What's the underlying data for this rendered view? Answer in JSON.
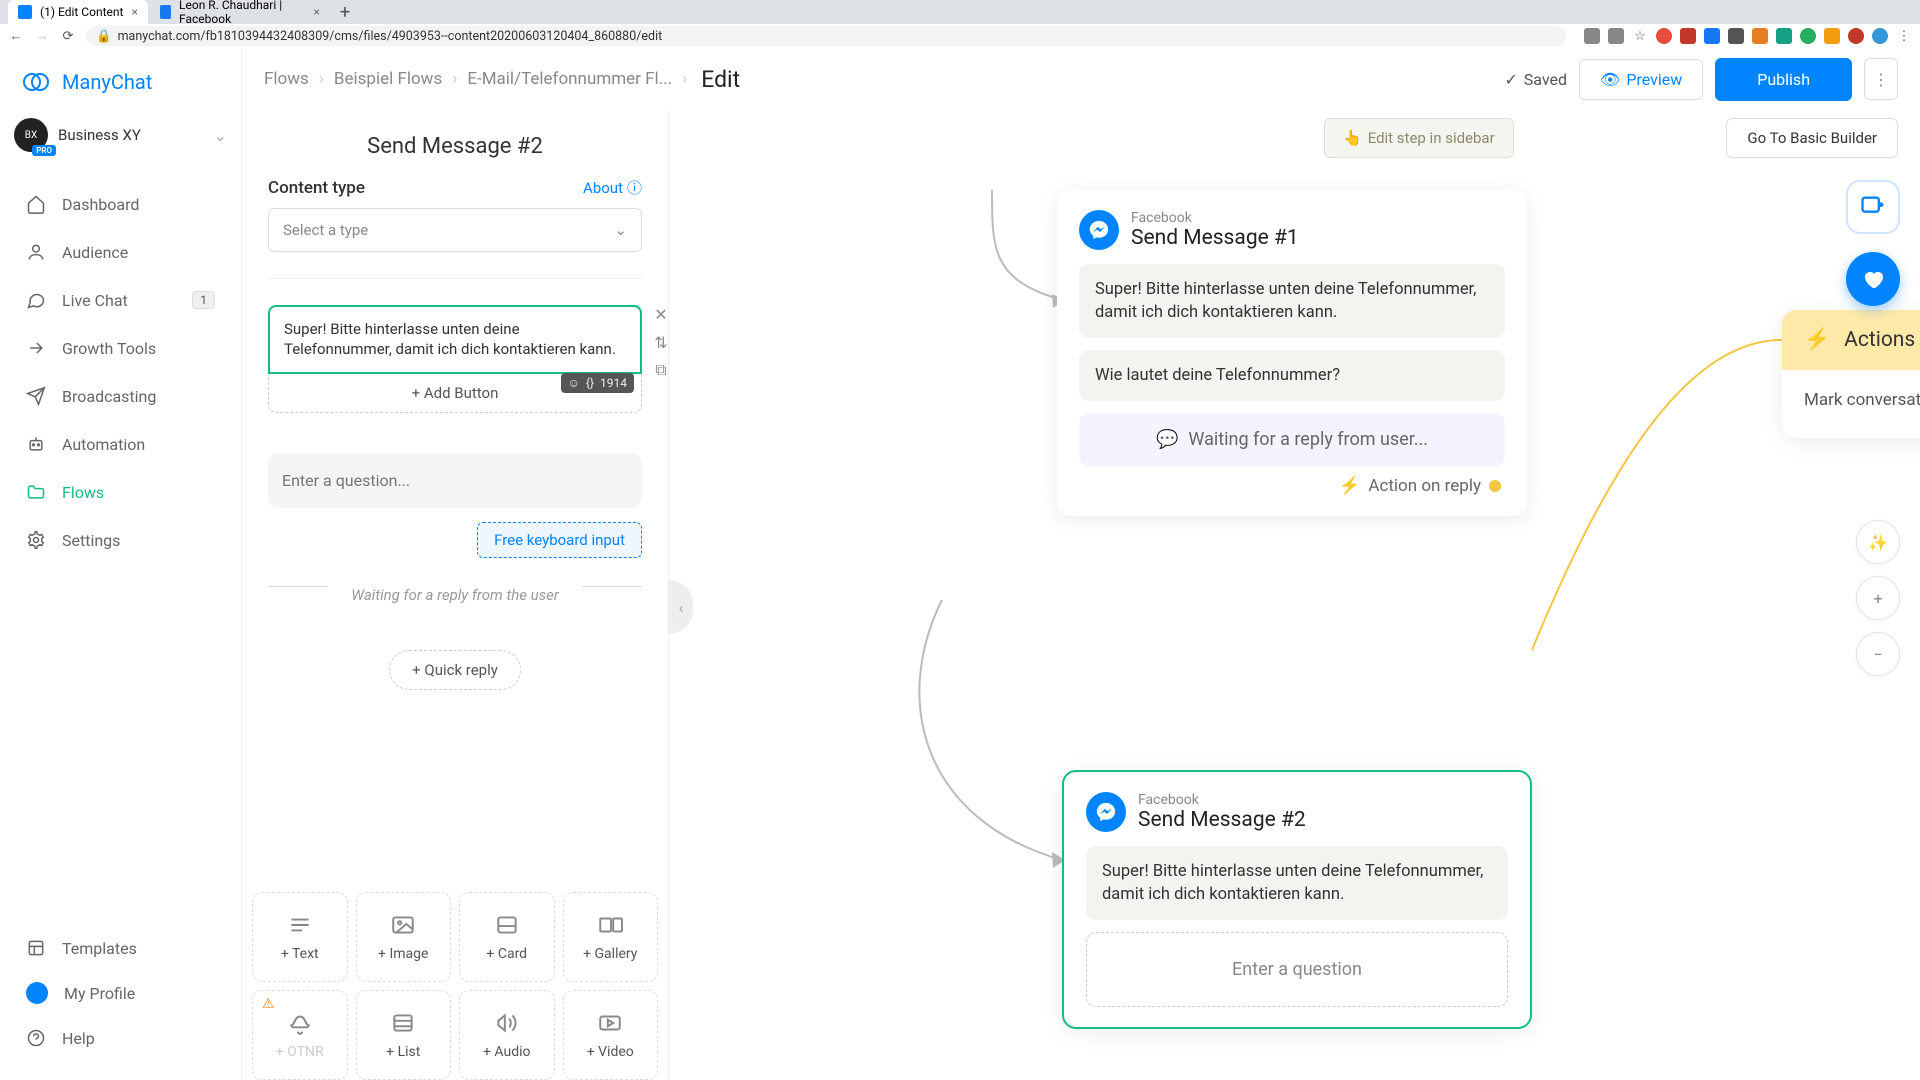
{
  "browser": {
    "tabs": [
      {
        "title": "(1) Edit Content",
        "favicon": "#0084ff"
      },
      {
        "title": "Leon R. Chaudhari | Facebook",
        "favicon": "#1877f2"
      }
    ],
    "url": "manychat.com/fb181039443240830​9/cms/files/4903953--content20200603120404_860880/edit"
  },
  "brand": "ManyChat",
  "org": {
    "name": "Business XY",
    "badge": "PRO"
  },
  "nav": {
    "items": [
      {
        "label": "Dashboard"
      },
      {
        "label": "Audience"
      },
      {
        "label": "Live Chat",
        "badge": "1"
      },
      {
        "label": "Growth Tools"
      },
      {
        "label": "Broadcasting"
      },
      {
        "label": "Automation"
      },
      {
        "label": "Flows",
        "active": true
      },
      {
        "label": "Settings"
      }
    ],
    "bottom": [
      {
        "label": "Templates"
      },
      {
        "label": "My Profile"
      },
      {
        "label": "Help"
      }
    ]
  },
  "breadcrumb": {
    "items": [
      "Flows",
      "Beispiel Flows",
      "E-Mail/Telefonnummer Fl..."
    ],
    "current": "Edit"
  },
  "topbar": {
    "saved": "Saved",
    "preview": "Preview",
    "publish": "Publish"
  },
  "canvas": {
    "edit_step": "Edit step in sidebar",
    "basic_builder": "Go To Basic Builder"
  },
  "editor": {
    "title": "Send Message #2",
    "content_type_label": "Content type",
    "about": "About",
    "select_placeholder": "Select a type",
    "message_text": "Super! Bitte hinterlasse unten deine Telefonnummer, damit ich dich kontaktieren kann.",
    "add_button": "+ Add Button",
    "char_count": "1914",
    "question_placeholder": "Enter a question...",
    "free_keyboard": "Free keyboard input",
    "waiting": "Waiting for a reply from the user",
    "quick_reply": "+ Quick reply",
    "blocks": [
      "+ Text",
      "+ Image",
      "+ Card",
      "+ Gallery",
      "+ OTNR",
      "+ List",
      "+ Audio",
      "+ Video"
    ]
  },
  "nodes": {
    "n1": {
      "platform": "Facebook",
      "title": "Send Message #1",
      "msg1": "Super! Bitte hinterlasse unten deine Telefonnummer, damit ich dich kontaktieren kann.",
      "msg2": "Wie lautet deine Telefonnummer?",
      "waiting": "Waiting for a reply from user...",
      "action_reply": "Action on reply"
    },
    "n2": {
      "platform": "Facebook",
      "title": "Send Message #2",
      "msg1": "Super! Bitte hinterlasse unten deine Telefonnummer, damit ich dich kontaktieren kann.",
      "question": "Enter a question"
    },
    "actions": {
      "title": "Actions",
      "body": "Mark conversation as Done"
    }
  }
}
